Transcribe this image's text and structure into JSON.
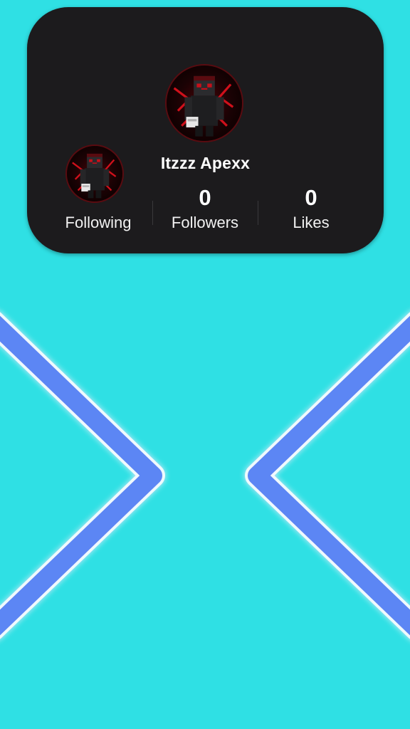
{
  "profile": {
    "username": "Itzzz Apexx",
    "avatar": "minecraft-skin-avatar-red",
    "stats": {
      "following": {
        "value": "",
        "label": "Following"
      },
      "followers": {
        "value": "0",
        "label": "Followers"
      },
      "likes": {
        "value": "0",
        "label": "Likes"
      }
    }
  },
  "colors": {
    "background": "#2fe0e4",
    "card": "#1c1b1d",
    "chevron": "#5b86f4",
    "avatar_accent": "#c8101a"
  }
}
